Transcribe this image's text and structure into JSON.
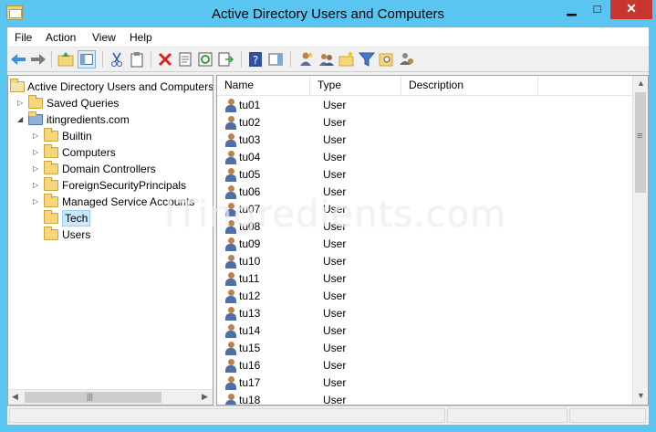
{
  "window": {
    "title": "Active Directory Users and Computers"
  },
  "titlebar_buttons": {
    "minimize": "▁",
    "maximize": "□",
    "close": "✕"
  },
  "menu": [
    "File",
    "Action",
    "View",
    "Help"
  ],
  "tree": [
    {
      "label": "Active Directory Users and Computers",
      "depth": 0,
      "toggle": "",
      "icon": "console-root-icon"
    },
    {
      "label": "Saved Queries",
      "depth": 1,
      "toggle": "▷",
      "icon": "folder-icon"
    },
    {
      "label": "itingredients.com",
      "depth": 1,
      "toggle": "◢",
      "icon": "domain-icon"
    },
    {
      "label": "Builtin",
      "depth": 2,
      "toggle": "▷",
      "icon": "folder-icon"
    },
    {
      "label": "Computers",
      "depth": 2,
      "toggle": "▷",
      "icon": "folder-icon"
    },
    {
      "label": "Domain Controllers",
      "depth": 2,
      "toggle": "▷",
      "icon": "ou-icon"
    },
    {
      "label": "ForeignSecurityPrincipals",
      "depth": 2,
      "toggle": "▷",
      "icon": "folder-icon"
    },
    {
      "label": "Managed Service Accounts",
      "depth": 2,
      "toggle": "▷",
      "icon": "folder-icon"
    },
    {
      "label": "Tech",
      "depth": 2,
      "toggle": "",
      "icon": "ou-icon",
      "selected": true
    },
    {
      "label": "Users",
      "depth": 2,
      "toggle": "",
      "icon": "folder-icon"
    }
  ],
  "list": {
    "columns": [
      "Name",
      "Type",
      "Description"
    ],
    "rows": [
      {
        "name": "tu01",
        "type": "User"
      },
      {
        "name": "tu02",
        "type": "User"
      },
      {
        "name": "tu03",
        "type": "User"
      },
      {
        "name": "tu04",
        "type": "User"
      },
      {
        "name": "tu05",
        "type": "User"
      },
      {
        "name": "tu06",
        "type": "User"
      },
      {
        "name": "tu07",
        "type": "User"
      },
      {
        "name": "tu08",
        "type": "User"
      },
      {
        "name": "tu09",
        "type": "User"
      },
      {
        "name": "tu10",
        "type": "User"
      },
      {
        "name": "tu11",
        "type": "User"
      },
      {
        "name": "tu12",
        "type": "User"
      },
      {
        "name": "tu13",
        "type": "User"
      },
      {
        "name": "tu14",
        "type": "User"
      },
      {
        "name": "tu15",
        "type": "User"
      },
      {
        "name": "tu16",
        "type": "User"
      },
      {
        "name": "tu17",
        "type": "User"
      },
      {
        "name": "tu18",
        "type": "User"
      }
    ]
  },
  "watermark": "ITingredients.com",
  "colors": {
    "titlebar": "#5bc5f2",
    "close": "#c7372f",
    "selection": "#cce8ff"
  }
}
